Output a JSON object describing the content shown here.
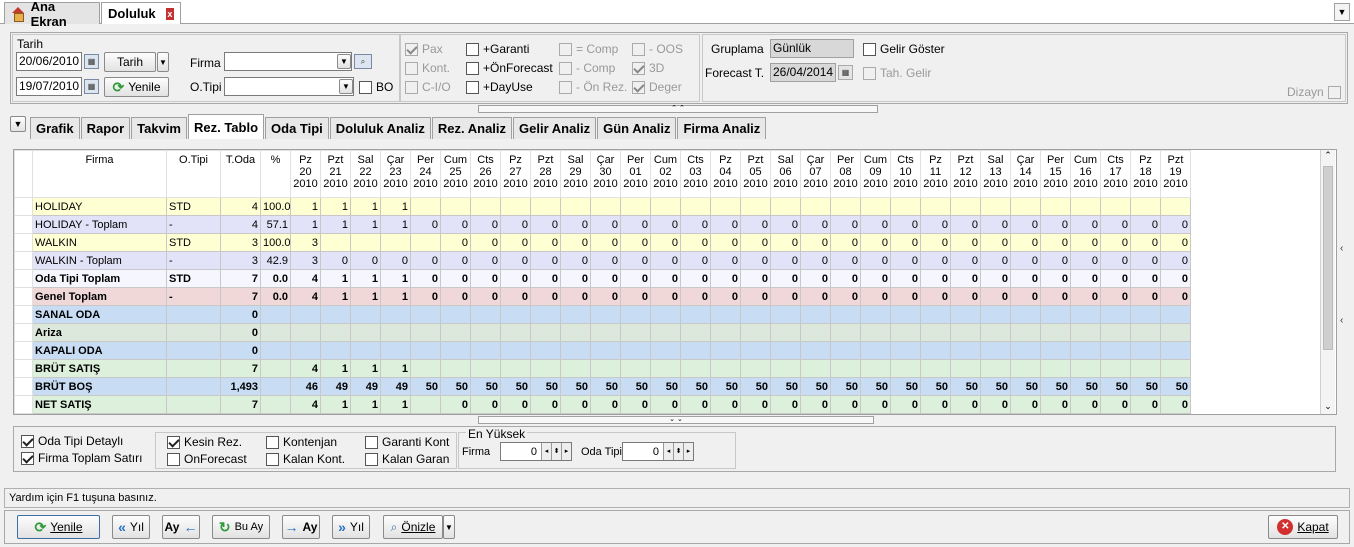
{
  "tabs": [
    {
      "label": "Ana Ekran"
    },
    {
      "label": "Doluluk"
    }
  ],
  "close_tab_glyph": "x",
  "filter": {
    "tarih_label": "Tarih",
    "date_from": "20/06/2010",
    "date_to": "19/07/2010",
    "tarih_button": "Tarih",
    "yenile_button": "Yenile",
    "firma_label": "Firma",
    "firma_value": "",
    "otipi_label": "O.Tipi",
    "otipi_value": "",
    "bo_label": "BO"
  },
  "options": {
    "col1": [
      {
        "label": "Pax",
        "checked": true,
        "disabled": true
      },
      {
        "label": "Kont.",
        "checked": false,
        "disabled": true
      },
      {
        "label": "C-I/O",
        "checked": false,
        "disabled": true
      }
    ],
    "col2": [
      {
        "label": "+Garanti",
        "checked": false,
        "disabled": false
      },
      {
        "label": "+ÖnForecast",
        "checked": false,
        "disabled": false
      },
      {
        "label": "+DayUse",
        "checked": false,
        "disabled": false
      }
    ],
    "col3": [
      {
        "label": "= Comp",
        "checked": false,
        "disabled": true
      },
      {
        "label": "- Comp",
        "checked": false,
        "disabled": true
      },
      {
        "label": "- Ön Rez.",
        "checked": false,
        "disabled": true
      }
    ],
    "col4": [
      {
        "label": "- OOS",
        "checked": false,
        "disabled": true
      },
      {
        "label": "3D",
        "checked": true,
        "disabled": true
      },
      {
        "label": "Deger",
        "checked": true,
        "disabled": true
      }
    ]
  },
  "grouping": {
    "gruplama_label": "Gruplama",
    "gruplama_value": "Günlük",
    "forecast_label": "Forecast T.",
    "forecast_value": "26/04/2014",
    "gelir_goster": "Gelir Göster",
    "tah_gelir": "Tah. Gelir",
    "dizayn": "Dizayn"
  },
  "subtabs": [
    {
      "label": "Grafik"
    },
    {
      "label": "Rapor"
    },
    {
      "label": "Takvim"
    },
    {
      "label": "Rez. Tablo",
      "active": true
    },
    {
      "label": "Oda Tipi"
    },
    {
      "label": "Doluluk Analiz"
    },
    {
      "label": "Rez. Analiz"
    },
    {
      "label": "Gelir Analiz"
    },
    {
      "label": "Gün Analiz"
    },
    {
      "label": "Firma Analiz"
    }
  ],
  "grid": {
    "header_firma": "Firma",
    "header_otipi": "O.Tipi",
    "header_toda": "T.Oda",
    "header_pct": "%",
    "days": [
      [
        "Pz",
        "20",
        "2010"
      ],
      [
        "Pzt",
        "21",
        "2010"
      ],
      [
        "Sal",
        "22",
        "2010"
      ],
      [
        "Çar",
        "23",
        "2010"
      ],
      [
        "Per",
        "24",
        "2010"
      ],
      [
        "Cum",
        "25",
        "2010"
      ],
      [
        "Cts",
        "26",
        "2010"
      ],
      [
        "Pz",
        "27",
        "2010"
      ],
      [
        "Pzt",
        "28",
        "2010"
      ],
      [
        "Sal",
        "29",
        "2010"
      ],
      [
        "Çar",
        "30",
        "2010"
      ],
      [
        "Per",
        "01",
        "2010"
      ],
      [
        "Cum",
        "02",
        "2010"
      ],
      [
        "Cts",
        "03",
        "2010"
      ],
      [
        "Pz",
        "04",
        "2010"
      ],
      [
        "Pzt",
        "05",
        "2010"
      ],
      [
        "Sal",
        "06",
        "2010"
      ],
      [
        "Çar",
        "07",
        "2010"
      ],
      [
        "Per",
        "08",
        "2010"
      ],
      [
        "Cum",
        "09",
        "2010"
      ],
      [
        "Cts",
        "10",
        "2010"
      ],
      [
        "Pz",
        "11",
        "2010"
      ],
      [
        "Pzt",
        "12",
        "2010"
      ],
      [
        "Sal",
        "13",
        "2010"
      ],
      [
        "Çar",
        "14",
        "2010"
      ],
      [
        "Per",
        "15",
        "2010"
      ],
      [
        "Cum",
        "16",
        "2010"
      ],
      [
        "Cts",
        "17",
        "2010"
      ],
      [
        "Pz",
        "18",
        "2010"
      ],
      [
        "Pzt",
        "19",
        "2010"
      ]
    ],
    "rows": [
      {
        "firma": "HOLIDAY",
        "otipi": "STD",
        "toda": "4",
        "pct": "100.0",
        "vals": [
          "1",
          "1",
          "1",
          "1",
          "",
          "",
          "",
          "",
          "",
          "",
          "",
          "",
          "",
          "",
          "",
          "",
          "",
          "",
          "",
          "",
          "",
          "",
          "",
          "",
          "",
          "",
          "",
          "",
          "",
          ""
        ]
      },
      {
        "firma": "HOLIDAY - Toplam",
        "otipi": "-",
        "toda": "4",
        "pct": "57.1",
        "vals": [
          "1",
          "1",
          "1",
          "1",
          "0",
          "0",
          "0",
          "0",
          "0",
          "0",
          "0",
          "0",
          "0",
          "0",
          "0",
          "0",
          "0",
          "0",
          "0",
          "0",
          "0",
          "0",
          "0",
          "0",
          "0",
          "0",
          "0",
          "0",
          "0",
          "0"
        ]
      },
      {
        "firma": "WALKIN",
        "otipi": "STD",
        "toda": "3",
        "pct": "100.0",
        "vals": [
          "3",
          "",
          "",
          "",
          "",
          "0",
          "0",
          "0",
          "0",
          "0",
          "0",
          "0",
          "0",
          "0",
          "0",
          "0",
          "0",
          "0",
          "0",
          "0",
          "0",
          "0",
          "0",
          "0",
          "0",
          "0",
          "0",
          "0",
          "0",
          "0"
        ]
      },
      {
        "firma": "WALKIN - Toplam",
        "otipi": "-",
        "toda": "3",
        "pct": "42.9",
        "vals": [
          "3",
          "0",
          "0",
          "0",
          "0",
          "0",
          "0",
          "0",
          "0",
          "0",
          "0",
          "0",
          "0",
          "0",
          "0",
          "0",
          "0",
          "0",
          "0",
          "0",
          "0",
          "0",
          "0",
          "0",
          "0",
          "0",
          "0",
          "0",
          "0",
          "0"
        ]
      },
      {
        "firma": "Oda Tipi Toplam",
        "otipi": "STD",
        "toda": "7",
        "pct": "0.0",
        "vals": [
          "4",
          "1",
          "1",
          "1",
          "0",
          "0",
          "0",
          "0",
          "0",
          "0",
          "0",
          "0",
          "0",
          "0",
          "0",
          "0",
          "0",
          "0",
          "0",
          "0",
          "0",
          "0",
          "0",
          "0",
          "0",
          "0",
          "0",
          "0",
          "0",
          "0"
        ]
      },
      {
        "firma": "Genel Toplam",
        "otipi": "-",
        "toda": "7",
        "pct": "0.0",
        "vals": [
          "4",
          "1",
          "1",
          "1",
          "0",
          "0",
          "0",
          "0",
          "0",
          "0",
          "0",
          "0",
          "0",
          "0",
          "0",
          "0",
          "0",
          "0",
          "0",
          "0",
          "0",
          "0",
          "0",
          "0",
          "0",
          "0",
          "0",
          "0",
          "0",
          "0"
        ]
      },
      {
        "firma": "SANAL ODA",
        "otipi": "",
        "toda": "0",
        "pct": "",
        "vals": [
          "",
          "",
          "",
          "",
          "",
          "",
          "",
          "",
          "",
          "",
          "",
          "",
          "",
          "",
          "",
          "",
          "",
          "",
          "",
          "",
          "",
          "",
          "",
          "",
          "",
          "",
          "",
          "",
          "",
          ""
        ]
      },
      {
        "firma": "Ariza",
        "otipi": "",
        "toda": "0",
        "pct": "",
        "vals": [
          "",
          "",
          "",
          "",
          "",
          "",
          "",
          "",
          "",
          "",
          "",
          "",
          "",
          "",
          "",
          "",
          "",
          "",
          "",
          "",
          "",
          "",
          "",
          "",
          "",
          "",
          "",
          "",
          "",
          ""
        ]
      },
      {
        "firma": "KAPALI ODA",
        "otipi": "",
        "toda": "0",
        "pct": "",
        "vals": [
          "",
          "",
          "",
          "",
          "",
          "",
          "",
          "",
          "",
          "",
          "",
          "",
          "",
          "",
          "",
          "",
          "",
          "",
          "",
          "",
          "",
          "",
          "",
          "",
          "",
          "",
          "",
          "",
          "",
          ""
        ]
      },
      {
        "firma": "BRÜT SATIŞ",
        "otipi": "",
        "toda": "7",
        "pct": "",
        "vals": [
          "4",
          "1",
          "1",
          "1",
          "",
          "",
          "",
          "",
          "",
          "",
          "",
          "",
          "",
          "",
          "",
          "",
          "",
          "",
          "",
          "",
          "",
          "",
          "",
          "",
          "",
          "",
          "",
          "",
          "",
          ""
        ]
      },
      {
        "firma": "BRÜT BOŞ",
        "otipi": "",
        "toda": "1,493",
        "pct": "",
        "vals": [
          "46",
          "49",
          "49",
          "49",
          "50",
          "50",
          "50",
          "50",
          "50",
          "50",
          "50",
          "50",
          "50",
          "50",
          "50",
          "50",
          "50",
          "50",
          "50",
          "50",
          "50",
          "50",
          "50",
          "50",
          "50",
          "50",
          "50",
          "50",
          "50",
          "50"
        ]
      },
      {
        "firma": "NET SATIŞ",
        "otipi": "",
        "toda": "7",
        "pct": "",
        "vals": [
          "4",
          "1",
          "1",
          "1",
          "",
          "0",
          "0",
          "0",
          "0",
          "0",
          "0",
          "0",
          "0",
          "0",
          "0",
          "0",
          "0",
          "0",
          "0",
          "0",
          "0",
          "0",
          "0",
          "0",
          "0",
          "0",
          "0",
          "0",
          "0",
          "0"
        ]
      }
    ]
  },
  "bottom_options": {
    "oda_tipi_detayli": "Oda Tipi Detaylı",
    "firma_toplam": "Firma Toplam Satırı",
    "kesin_rez": "Kesin Rez.",
    "onforecast": "OnForecast",
    "kontenjan": "Kontenjan",
    "kalan_kont": "Kalan Kont.",
    "garanti_kont": "Garanti Kont",
    "kalan_garan": "Kalan Garan",
    "en_yuksek": "En Yüksek",
    "firma_label": "Firma",
    "firma_val": "0",
    "oda_tipi_label": "Oda Tipi",
    "oda_tipi_val": "0"
  },
  "status_text": "Yardım için F1 tuşuna basınız.",
  "bottom_buttons": {
    "yenile": "Yenile",
    "yil_prev": "Yıl",
    "ay_prev": "Ay",
    "bu_ay": "Bu Ay",
    "ay_next": "Ay",
    "yil_next": "Yıl",
    "onizle": "Önizle",
    "kapat": "Kapat"
  }
}
